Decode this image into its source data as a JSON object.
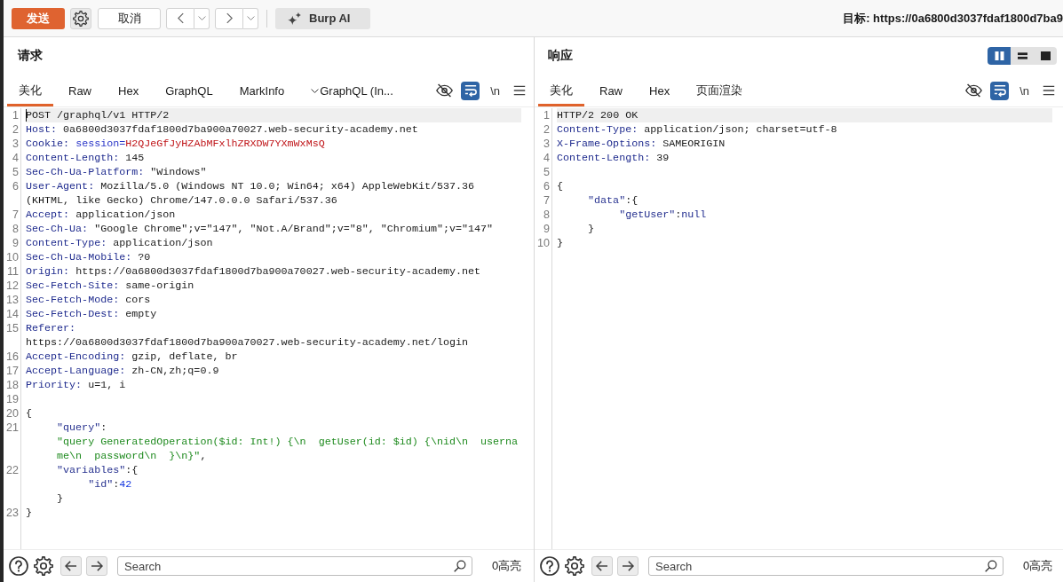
{
  "toolbar": {
    "send_button": "发送",
    "cancel_button": "取消",
    "ai_button": "Burp AI",
    "target": "目标: https://0a6800d3037fdaf1800d7ba9"
  },
  "panes": [
    {
      "title": "请求",
      "tabs": [
        {
          "label": "美化",
          "kind": "plain",
          "selected": true
        },
        {
          "label": "Raw",
          "kind": "plain",
          "selected": false
        },
        {
          "label": "Hex",
          "kind": "plain",
          "selected": false
        },
        {
          "label": "GraphQL",
          "kind": "plain",
          "selected": false
        },
        {
          "label": "MarkInfo",
          "kind": "plain",
          "selected": false
        },
        {
          "label": "GraphQL (In...",
          "kind": "dropdown",
          "selected": false
        }
      ],
      "word_wrap": true,
      "newline_toggle": "\\n",
      "focused": true,
      "lines": [
        {
          "n": "1",
          "current": true,
          "tokens": [
            {
              "kind": "plain",
              "text": "POST /graphql/v1 HTTP/2"
            }
          ]
        },
        {
          "n": "2",
          "current": false,
          "tokens": [
            {
              "kind": "key",
              "text": "Host:"
            },
            {
              "kind": "value",
              "text": " 0a6800d3037fdaf1800d7ba900a70027.web-security-academy.net"
            }
          ]
        },
        {
          "n": "3",
          "current": false,
          "tokens": [
            {
              "kind": "key",
              "text": "Cookie:"
            },
            {
              "kind": "param-name",
              "text": " session="
            },
            {
              "kind": "param-value",
              "text": "H2QJeGfJyHZAbMFxlhZRXDW7YXmWxMsQ"
            }
          ]
        },
        {
          "n": "4",
          "current": false,
          "tokens": [
            {
              "kind": "key",
              "text": "Content-Length:"
            },
            {
              "kind": "value",
              "text": " 145"
            }
          ]
        },
        {
          "n": "5",
          "current": false,
          "tokens": [
            {
              "kind": "key",
              "text": "Sec-Ch-Ua-Platform:"
            },
            {
              "kind": "value",
              "text": " \"Windows\""
            }
          ]
        },
        {
          "n": "6",
          "current": false,
          "tokens": [
            {
              "kind": "key",
              "text": "User-Agent:"
            },
            {
              "kind": "value",
              "text": " Mozilla/5.0 (Windows NT 10.0; Win64; x64) AppleWebKit/537.36 (KHTML, like Gecko) Chrome/147.0.0.0 Safari/537.36"
            }
          ]
        },
        {
          "n": "7",
          "current": false,
          "tokens": [
            {
              "kind": "key",
              "text": "Accept:"
            },
            {
              "kind": "value",
              "text": " application/json"
            }
          ]
        },
        {
          "n": "8",
          "current": false,
          "tokens": [
            {
              "kind": "key",
              "text": "Sec-Ch-Ua:"
            },
            {
              "kind": "value",
              "text": " \"Google Chrome\";v=\"147\", \"Not.A/Brand\";v=\"8\", \"Chromium\";v=\"147\""
            }
          ]
        },
        {
          "n": "9",
          "current": false,
          "tokens": [
            {
              "kind": "key",
              "text": "Content-Type:"
            },
            {
              "kind": "value",
              "text": " application/json"
            }
          ]
        },
        {
          "n": "10",
          "current": false,
          "tokens": [
            {
              "kind": "key",
              "text": "Sec-Ch-Ua-Mobile:"
            },
            {
              "kind": "value",
              "text": " ?0"
            }
          ]
        },
        {
          "n": "11",
          "current": false,
          "tokens": [
            {
              "kind": "key",
              "text": "Origin:"
            },
            {
              "kind": "value",
              "text": " https://0a6800d3037fdaf1800d7ba900a70027.web-security-academy.net"
            }
          ]
        },
        {
          "n": "12",
          "current": false,
          "tokens": [
            {
              "kind": "key",
              "text": "Sec-Fetch-Site:"
            },
            {
              "kind": "value",
              "text": " same-origin"
            }
          ]
        },
        {
          "n": "13",
          "current": false,
          "tokens": [
            {
              "kind": "key",
              "text": "Sec-Fetch-Mode:"
            },
            {
              "kind": "value",
              "text": " cors"
            }
          ]
        },
        {
          "n": "14",
          "current": false,
          "tokens": [
            {
              "kind": "key",
              "text": "Sec-Fetch-Dest:"
            },
            {
              "kind": "value",
              "text": " empty"
            }
          ]
        },
        {
          "n": "15",
          "current": false,
          "tokens": [
            {
              "kind": "key",
              "text": "Referer:"
            },
            {
              "kind": "value",
              "text": " https://0a6800d3037fdaf1800d7ba900a70027.web-security-academy.net/login"
            }
          ]
        },
        {
          "n": "16",
          "current": false,
          "tokens": [
            {
              "kind": "key",
              "text": "Accept-Encoding:"
            },
            {
              "kind": "value",
              "text": " gzip, deflate, br"
            }
          ]
        },
        {
          "n": "17",
          "current": false,
          "tokens": [
            {
              "kind": "key",
              "text": "Accept-Language:"
            },
            {
              "kind": "value",
              "text": " zh-CN,zh;q=0.9"
            }
          ]
        },
        {
          "n": "18",
          "current": false,
          "tokens": [
            {
              "kind": "key",
              "text": "Priority:"
            },
            {
              "kind": "value",
              "text": " u=1, i"
            }
          ]
        },
        {
          "n": "19",
          "current": false
        },
        {
          "n": "20",
          "current": false,
          "tokens": [
            {
              "kind": "punct",
              "text": "{"
            }
          ]
        },
        {
          "n": "21",
          "current": false,
          "tokens": [
            {
              "kind": "json-key",
              "text": "     \"query\""
            },
            {
              "kind": "punct",
              "text": ":"
            },
            {
              "kind": "string",
              "text": "\"query GeneratedOperation($id: Int!) {\\n  getUser(id: $id) {\\nid\\n  username\\n  password\\n  }\\n}\""
            },
            {
              "kind": "punct",
              "text": ","
            }
          ]
        },
        {
          "n": "22",
          "current": false,
          "tokens": [
            {
              "kind": "json-key",
              "text": "     \"variables\""
            },
            {
              "kind": "punct",
              "text": ":{"
            }
          ]
        },
        {
          "current": false,
          "tokens": [
            {
              "kind": "json-key",
              "text": "          \"id\""
            },
            {
              "kind": "punct",
              "text": ":"
            },
            {
              "kind": "number",
              "text": "42"
            }
          ]
        },
        {
          "current": false,
          "tokens": [
            {
              "kind": "punct",
              "text": "     }"
            }
          ]
        },
        {
          "n": "23",
          "current": false,
          "tokens": [
            {
              "kind": "punct",
              "text": "}"
            }
          ]
        }
      ],
      "search": {
        "placeholder": "Search"
      },
      "highlight_count": "0高亮"
    },
    {
      "title": "响应",
      "layout_modes": [
        {
          "kind": "side-by-side",
          "selected": true
        },
        {
          "kind": "stacked",
          "selected": false
        },
        {
          "kind": "single",
          "selected": false
        }
      ],
      "tabs": [
        {
          "label": "美化",
          "kind": "plain",
          "selected": true
        },
        {
          "label": "Raw",
          "kind": "plain",
          "selected": false
        },
        {
          "label": "Hex",
          "kind": "plain",
          "selected": false
        },
        {
          "label": "页面渲染",
          "kind": "plain",
          "selected": false
        }
      ],
      "word_wrap": true,
      "newline_toggle": "\\n",
      "focused": false,
      "lines": [
        {
          "n": "1",
          "current": true,
          "tokens": [
            {
              "kind": "plain",
              "text": "HTTP/2 200 OK"
            }
          ]
        },
        {
          "n": "2",
          "current": false,
          "tokens": [
            {
              "kind": "key",
              "text": "Content-Type:"
            },
            {
              "kind": "value",
              "text": " application/json; charset=utf-8"
            }
          ]
        },
        {
          "n": "3",
          "current": false,
          "tokens": [
            {
              "kind": "key",
              "text": "X-Frame-Options:"
            },
            {
              "kind": "value",
              "text": " SAMEORIGIN"
            }
          ]
        },
        {
          "n": "4",
          "current": false,
          "tokens": [
            {
              "kind": "key",
              "text": "Content-Length:"
            },
            {
              "kind": "value",
              "text": " 39"
            }
          ]
        },
        {
          "n": "5",
          "current": false
        },
        {
          "n": "6",
          "current": false,
          "tokens": [
            {
              "kind": "punct",
              "text": "{"
            }
          ]
        },
        {
          "n": "7",
          "current": false,
          "tokens": [
            {
              "kind": "json-key",
              "text": "     \"data\""
            },
            {
              "kind": "punct",
              "text": ":{"
            }
          ]
        },
        {
          "n": "8",
          "current": false,
          "tokens": [
            {
              "kind": "json-key",
              "text": "          \"getUser\""
            },
            {
              "kind": "punct",
              "text": ":"
            },
            {
              "kind": "literal",
              "text": "null"
            }
          ]
        },
        {
          "n": "9",
          "current": false,
          "tokens": [
            {
              "kind": "punct",
              "text": "     }"
            }
          ]
        },
        {
          "n": "10",
          "current": false,
          "tokens": [
            {
              "kind": "punct",
              "text": "}"
            }
          ]
        }
      ],
      "search": {
        "placeholder": "Search"
      },
      "highlight_count": "0高亮"
    }
  ]
}
